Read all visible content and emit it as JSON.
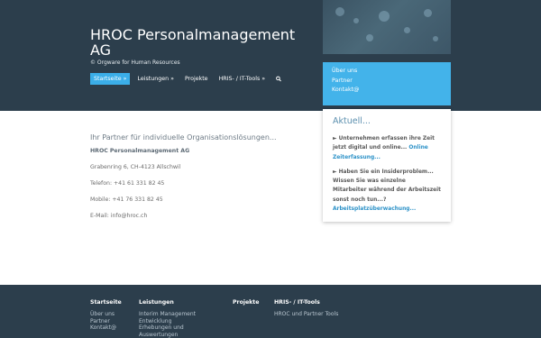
{
  "header": {
    "title": "HROC Personalmanagement AG",
    "subtitle": "© Orgware for Human Resources"
  },
  "nav": {
    "items": [
      {
        "label": "Startseite »",
        "active": true
      },
      {
        "label": "Leistungen »",
        "active": false
      },
      {
        "label": "Projekte",
        "active": false
      },
      {
        "label": "HRIS- / IT-Tools »",
        "active": false
      }
    ],
    "search_icon": "search-icon"
  },
  "side_links": [
    "Über uns",
    "Partner",
    "Kontakt@"
  ],
  "main": {
    "heading": "Ihr Partner für individuelle Organisationslösungen...",
    "company": "HROC Personalmanagement AG",
    "address": "Grabenring 6, CH-4123 Allschwil",
    "phone": "Telefon: +41 61 331 82 45",
    "mobile": "Mobile: +41 76 331 82 45",
    "email": "E-Mail: info@hroc.ch"
  },
  "news": {
    "title": "Aktuell...",
    "items": [
      {
        "text": "► Unternehmen erfassen ihre Zeit jetzt digital und online...",
        "link": "Online Zeiterfassung..."
      },
      {
        "text": "► Haben Sie ein Insiderproblem... Wissen Sie was einzelne Mitarbeiter während der Arbeitszeit sonst noch tun...?",
        "link": "Arbeitsplatzüberwachung..."
      }
    ]
  },
  "footer": {
    "columns": [
      {
        "heading": "Startseite",
        "links": [
          "Über uns",
          "Partner",
          "Kontakt@"
        ]
      },
      {
        "heading": "Leistungen",
        "links": [
          "Interim Management",
          "Entwicklung",
          "Erhebungen und",
          "Auswertungen"
        ]
      },
      {
        "heading": "Projekte",
        "links": []
      },
      {
        "heading": "HRIS- / IT-Tools",
        "links": [
          "HROC und Partner Tools"
        ]
      }
    ]
  },
  "colors": {
    "header_bg": "#2c3e4c",
    "accent": "#43b3ea",
    "link": "#2d92c8"
  }
}
